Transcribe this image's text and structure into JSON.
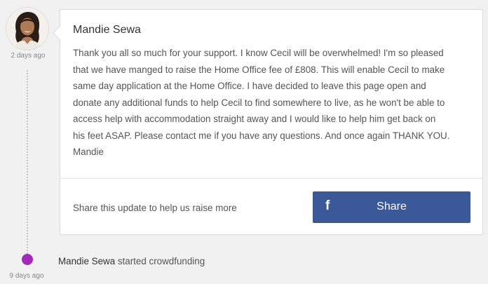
{
  "update": {
    "time": "2 days ago",
    "author": "Mandie Sewa",
    "body": "Thank you all so much for your support. I know Cecil will be overwhelmed! I'm so pleased\nthat we have manged to raise the Home Office fee of £808. This will enable Cecil to make\nsame day application at the Home Office. I have decided to leave this page open and\ndonate any additional funds to help Cecil to find somewhere to live, as he won't be able to\naccess help with accommodation straight away and I would like to help him get back on\nhis feet ASAP. Please contact me if you have any questions. And once again THANK YOU.\nMandie",
    "share_prompt": "Share this update to help us raise more",
    "share_button": "Share",
    "share_icon": "f"
  },
  "event": {
    "author": "Mandie Sewa",
    "action": " started crowdfunding",
    "time": "9 days ago"
  },
  "colors": {
    "facebook": "#3b5998",
    "event_dot": "#a12ab8"
  }
}
